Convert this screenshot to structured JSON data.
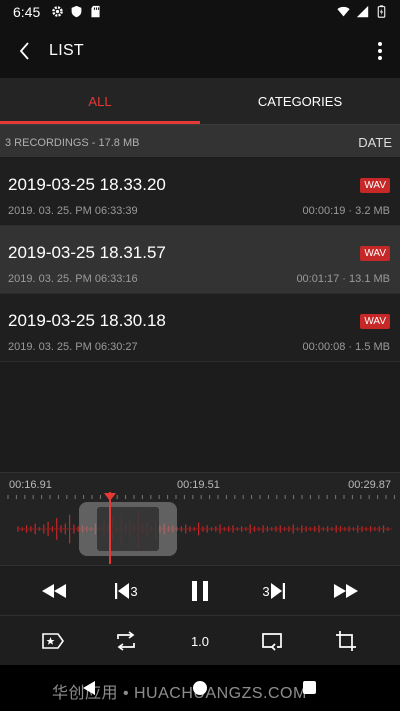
{
  "status_bar": {
    "time": "6:45",
    "left_icons": [
      "gear-icon",
      "shield-icon",
      "sd-card-icon"
    ],
    "right_icons": [
      "wifi-icon",
      "signal-icon",
      "battery-charging-icon"
    ]
  },
  "app_bar": {
    "title": "LIST"
  },
  "tabs": [
    {
      "label": "ALL",
      "active": true
    },
    {
      "label": "CATEGORIES",
      "active": false
    }
  ],
  "summary": {
    "text": "3 RECORDINGS - 17.8 MB",
    "sort_label": "DATE"
  },
  "recordings": [
    {
      "title": "2019-03-25 18.33.20",
      "format": "WAV",
      "date": "2019. 03. 25. PM 06:33:39",
      "meta": "00:00:19 · 3.2 MB",
      "selected": false
    },
    {
      "title": "2019-03-25 18.31.57",
      "format": "WAV",
      "date": "2019. 03. 25. PM 06:33:16",
      "meta": "00:01:17 · 13.1 MB",
      "selected": true
    },
    {
      "title": "2019-03-25 18.30.18",
      "format": "WAV",
      "date": "2019. 03. 25. PM 06:30:27",
      "meta": "00:00:08 · 1.5 MB",
      "selected": false
    }
  ],
  "timeline": {
    "labels": [
      "00:16.91",
      "00:19.51",
      "00:29.87"
    ]
  },
  "transport": {
    "skip_back_seconds": "3",
    "skip_forward_seconds": "3"
  },
  "toolbar": {
    "speed": "1.0"
  },
  "watermark": "华创应用 • HUACHUANGZS.COM",
  "colors": {
    "accent": "#e53935",
    "badge": "#c62828",
    "background": "#1c1c1c"
  }
}
